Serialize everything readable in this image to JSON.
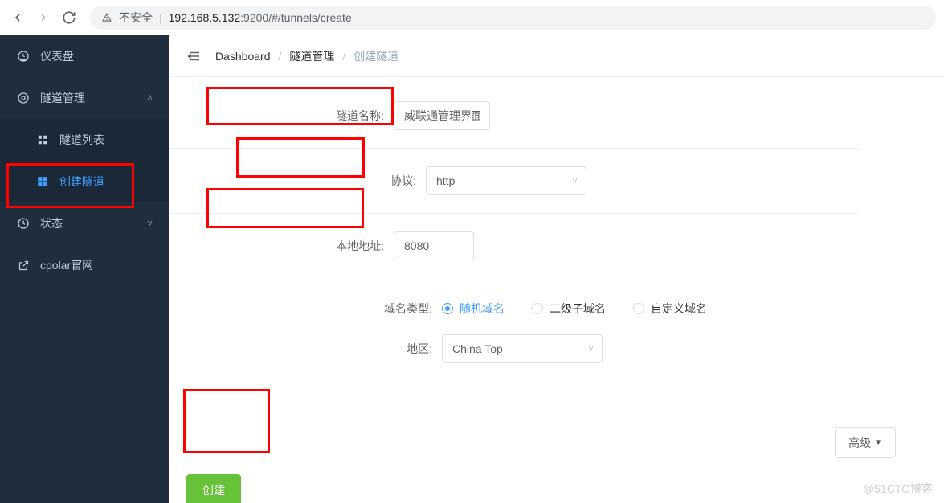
{
  "browser": {
    "insecure_label": "不安全",
    "url_host": "192.168.5.132",
    "url_port": ":9200",
    "url_path": "/#/tunnels/create"
  },
  "sidebar": {
    "items": [
      {
        "label": "仪表盘"
      },
      {
        "label": "隧道管理"
      },
      {
        "label": "隧道列表"
      },
      {
        "label": "创建隧道"
      },
      {
        "label": "状态"
      },
      {
        "label": "cpolar官网"
      }
    ]
  },
  "breadcrumb": {
    "item1": "Dashboard",
    "item2": "隧道管理",
    "item3": "创建隧道"
  },
  "form": {
    "tunnel_name_label": "隧道名称:",
    "tunnel_name_value": "威联通管理界面",
    "protocol_label": "协议:",
    "protocol_value": "http",
    "local_addr_label": "本地地址:",
    "local_addr_value": "8080",
    "domain_type_label": "域名类型:",
    "domain_type_options": {
      "opt1": "随机域名",
      "opt2": "二级子域名",
      "opt3": "自定义域名"
    },
    "region_label": "地区:",
    "region_value": "China Top",
    "advanced_label": "高级",
    "submit_label": "创建"
  },
  "watermark": "@51CTO博客"
}
